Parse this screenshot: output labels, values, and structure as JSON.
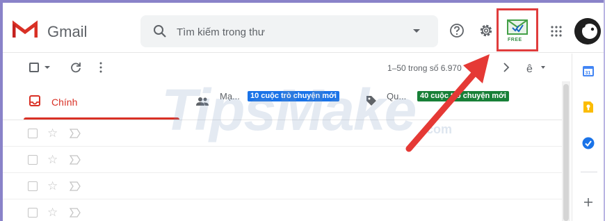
{
  "header": {
    "app_name": "Gmail",
    "search_placeholder": "Tìm kiếm trong thư",
    "addon_badge": "FREE"
  },
  "toolbar": {
    "pagination": "1–50 trong số 6.970"
  },
  "tabs": [
    {
      "label": "Chính"
    },
    {
      "label": "Mạ...",
      "badge": "10 cuộc trò chuyện mới",
      "badge_color": "#1a73e8"
    },
    {
      "label": "Qu...",
      "badge": "40 cuộc trò chuyện mới",
      "badge_color": "#188038"
    }
  ],
  "watermark": {
    "text": "TipsMake",
    "suffix": ".com"
  },
  "colors": {
    "accent": "#d93025",
    "highlight_box": "#e03c3c",
    "arrow": "#e53935"
  },
  "icons": [
    "gmail-logo",
    "search-icon",
    "help-icon",
    "settings-icon",
    "addon-icon",
    "apps-grid-icon",
    "avatar",
    "refresh-icon",
    "more-vert-icon",
    "chevron-left-icon",
    "chevron-right-icon",
    "input-tools-icon",
    "inbox-icon",
    "people-icon",
    "tag-icon",
    "star-icon",
    "important-icon",
    "calendar-icon",
    "keep-icon",
    "tasks-icon",
    "plus-icon"
  ]
}
